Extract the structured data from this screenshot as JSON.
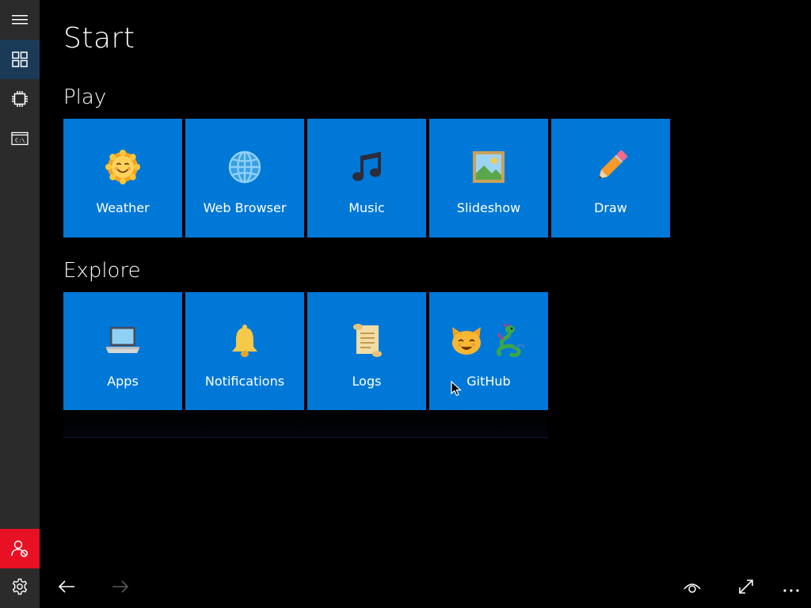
{
  "page": {
    "title": "Start"
  },
  "colors": {
    "tile": "#0078d7",
    "rail": "#2b2b2b",
    "rail_selected": "#1b3a57",
    "alert": "#e81123",
    "background": "#000000"
  },
  "rail": {
    "items": [
      {
        "icon": "hamburger-menu-icon"
      },
      {
        "icon": "tiles-grid-icon",
        "selected": true
      },
      {
        "icon": "chip-icon"
      },
      {
        "icon": "command-prompt-icon"
      }
    ],
    "bottom": {
      "icon": "user-blocked-icon"
    }
  },
  "groups": [
    {
      "title": "Play",
      "tiles": [
        {
          "label": "Weather",
          "icon": "smiling-sun-icon"
        },
        {
          "label": "Web Browser",
          "icon": "globe-icon"
        },
        {
          "label": "Music",
          "icon": "music-note-icon"
        },
        {
          "label": "Slideshow",
          "icon": "framed-picture-icon"
        },
        {
          "label": "Draw",
          "icon": "pencil-icon"
        }
      ]
    },
    {
      "title": "Explore",
      "tiles": [
        {
          "label": "Apps",
          "icon": "laptop-icon"
        },
        {
          "label": "Notifications",
          "icon": "bell-icon"
        },
        {
          "label": "Logs",
          "icon": "scroll-icon"
        },
        {
          "label": "GitHub",
          "icon": "cat-and-dragon-icon"
        }
      ]
    }
  ],
  "bottombar": {
    "left": [
      "settings-gear-icon",
      "back-arrow-icon",
      "forward-arrow-icon"
    ],
    "right": [
      "eye-icon",
      "fullscreen-icon",
      "more-icon"
    ]
  }
}
